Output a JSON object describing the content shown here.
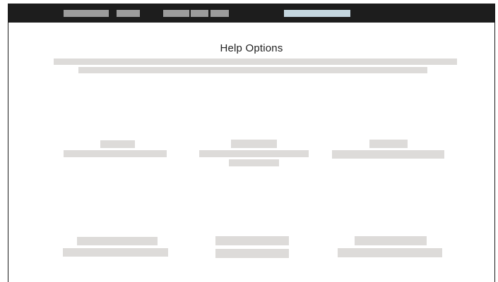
{
  "page": {
    "title": "Help Options"
  },
  "colors": {
    "topbar_background": "#1d1d1d",
    "nav_placeholder": "#9c9c9c",
    "search_placeholder": "#c4d6df",
    "content_placeholder": "#dddbd9",
    "frame_border": "#1a1a1a"
  },
  "note_on_placeholders": ""
}
